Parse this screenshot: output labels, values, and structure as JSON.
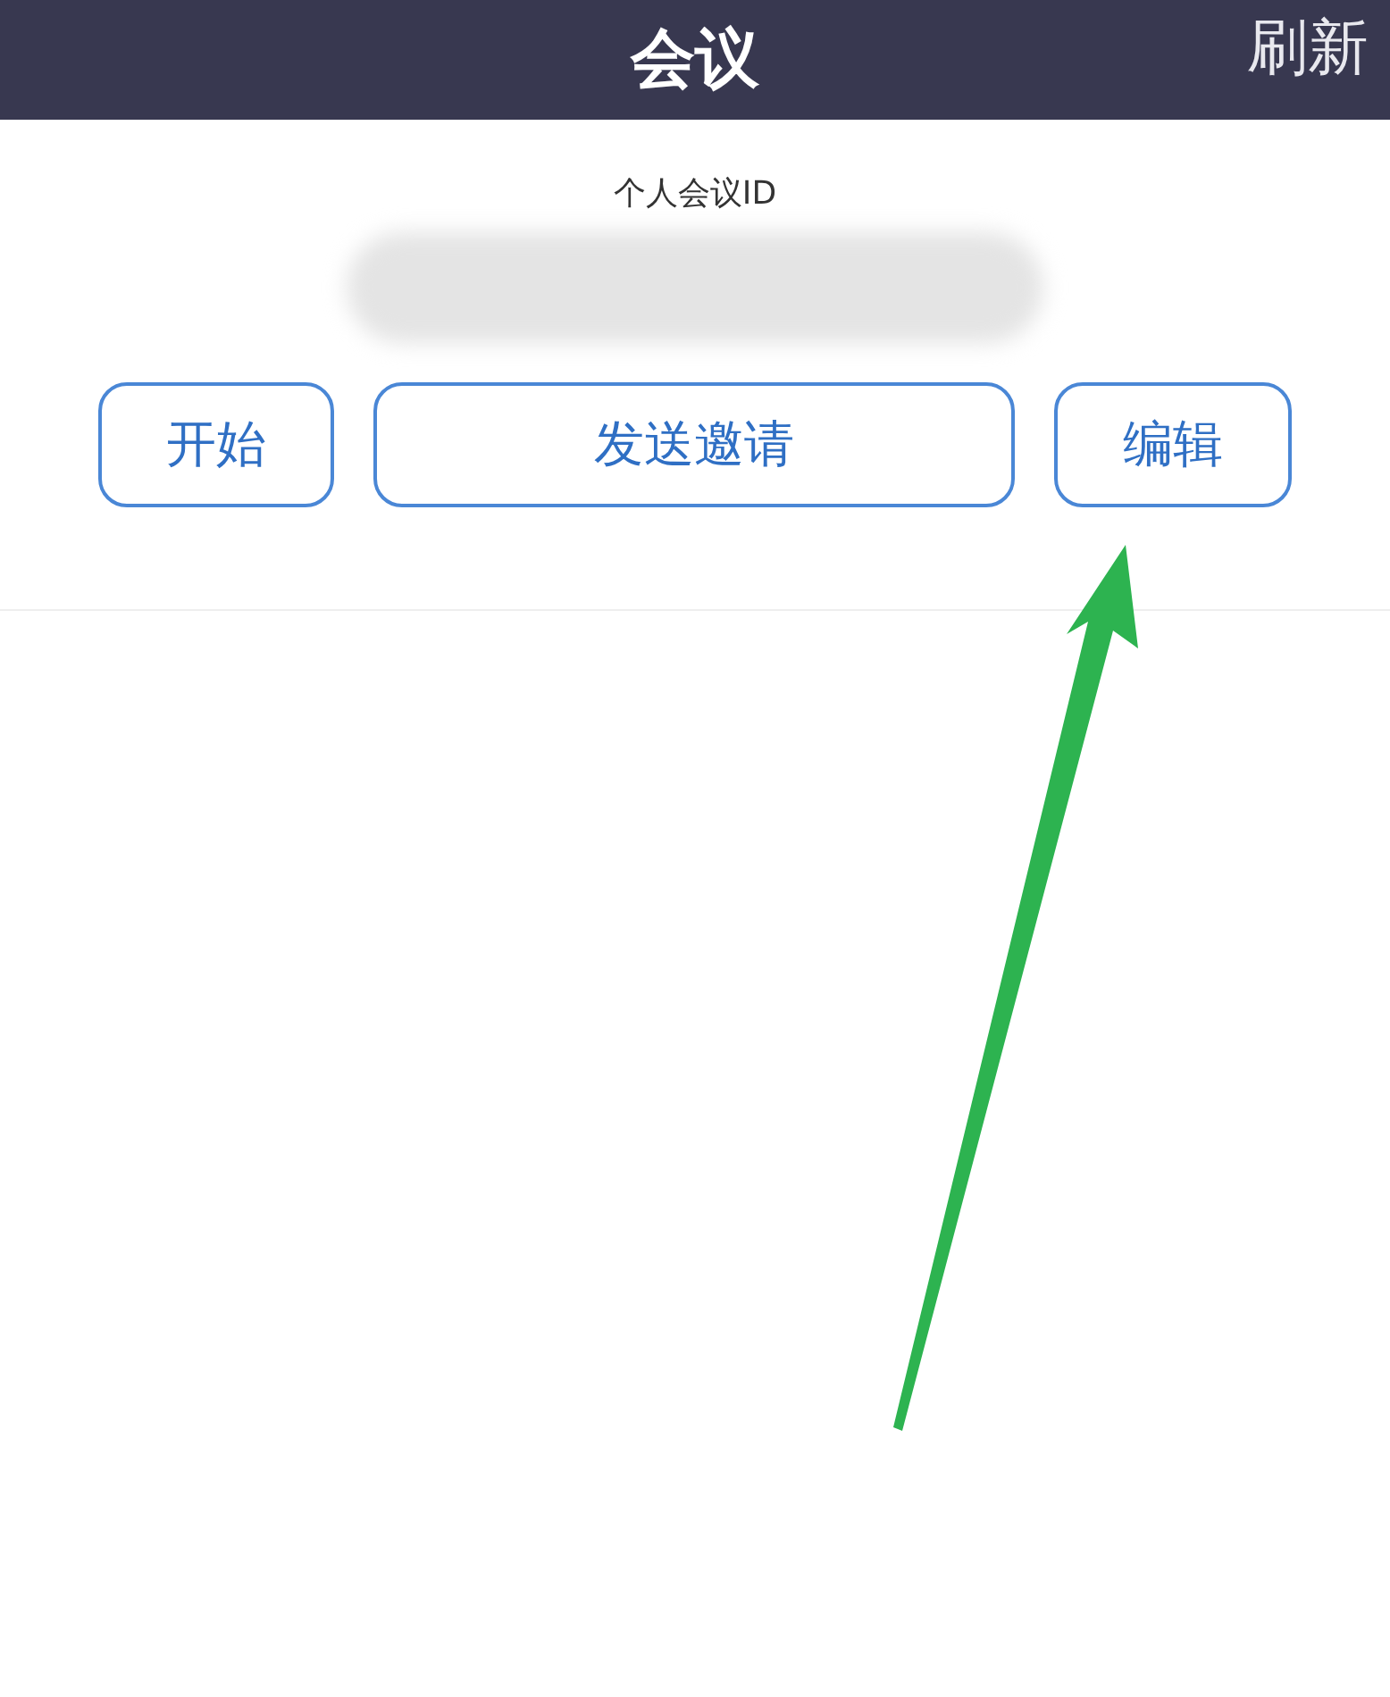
{
  "header": {
    "title": "会议",
    "action": "刷新"
  },
  "meeting": {
    "id_label": "个人会议ID"
  },
  "buttons": [
    {
      "label": "开始"
    },
    {
      "label": "发送邀请"
    },
    {
      "label": "编辑"
    }
  ]
}
